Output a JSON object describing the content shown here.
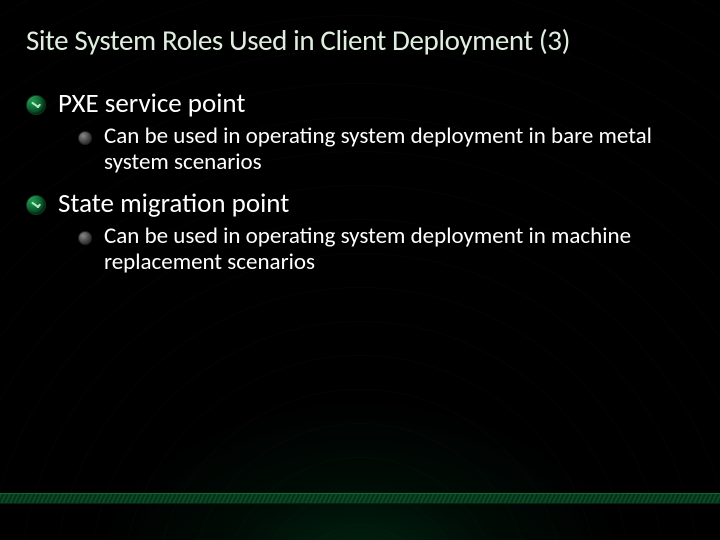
{
  "title": "Site System Roles Used in Client Deployment (3)",
  "items": [
    {
      "label": "PXE service point",
      "sub": [
        "Can be used in operating system deployment in bare metal system scenarios"
      ]
    },
    {
      "label": "State migration point",
      "sub": [
        "Can be used in operating system deployment in machine replacement scenarios"
      ]
    }
  ]
}
